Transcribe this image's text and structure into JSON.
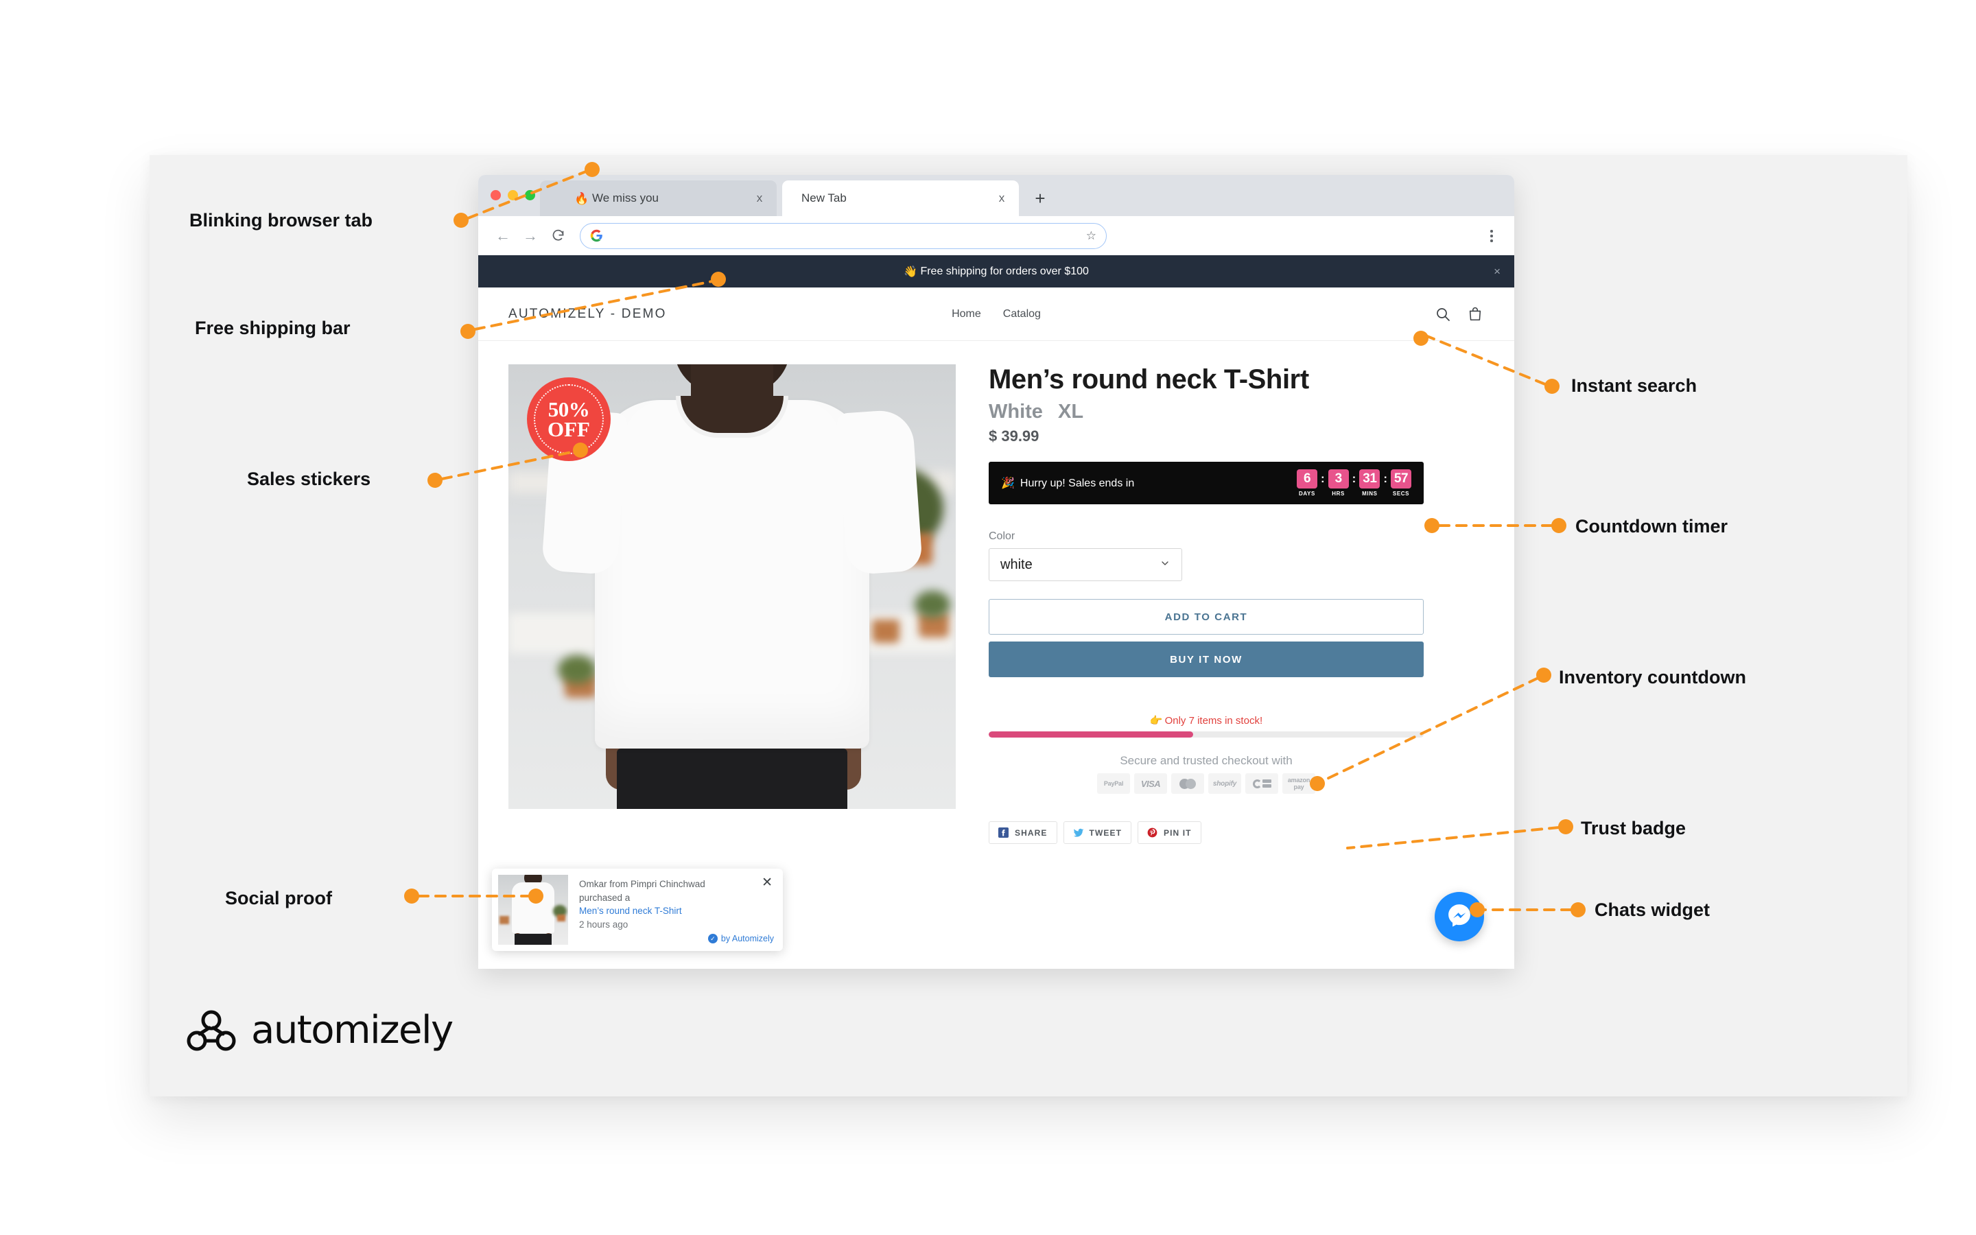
{
  "browser": {
    "tabs": [
      {
        "title": "We miss you",
        "favicon": "🔥",
        "active": false,
        "close_icon": "x"
      },
      {
        "title": "New Tab",
        "favicon": "",
        "active": true,
        "close_icon": "x"
      }
    ],
    "new_tab_icon": "+",
    "back_icon": "←",
    "forward_icon": "→",
    "reload_icon": "⟳",
    "omnibox_value": "",
    "omnibox_placeholder": "",
    "search_engine_icon": "google-g",
    "bookmark_icon": "☆",
    "menu_icon": "kebab"
  },
  "store": {
    "shipping_bar": {
      "emoji": "👋",
      "text": "Free shipping for orders over $100",
      "close_icon": "×"
    },
    "brand": "AUTOMIZELY - DEMO",
    "nav": [
      "Home",
      "Catalog"
    ],
    "search_icon": "search-icon",
    "cart_icon": "cart-icon"
  },
  "product": {
    "sticker": {
      "line1": "50%",
      "line2": "OFF"
    },
    "title": "Men’s round neck T-Shirt",
    "variant_color": "White",
    "variant_size": "XL",
    "price": "$ 39.99",
    "timer": {
      "emoji": "🎉",
      "message": "Hurry up! Sales ends in",
      "units": [
        {
          "value": "6",
          "label": "DAYS"
        },
        {
          "value": "3",
          "label": "HRS"
        },
        {
          "value": "31",
          "label": "MINS"
        },
        {
          "value": "57",
          "label": "SECS"
        }
      ],
      "separator": ":"
    },
    "option_label": "Color",
    "option_value": "white",
    "option_chevron": "⌄",
    "add_to_cart": "ADD TO CART",
    "buy_it_now": "BUY IT NOW",
    "stock": {
      "emoji": "👉",
      "text": "Only 7 items in stock!",
      "fill_percent": 47,
      "fill_color": "#da4a7b"
    },
    "trust": {
      "heading": "Secure and trusted checkout with",
      "badges": [
        "PayPal",
        "VISA",
        "mastercard",
        "shopify",
        "CB",
        "amazon pay"
      ]
    },
    "share": [
      {
        "label": "SHARE",
        "icon": "facebook-icon",
        "color": "#3b5998"
      },
      {
        "label": "TWEET",
        "icon": "twitter-icon",
        "color": "#4cb3ec"
      },
      {
        "label": "PIN IT",
        "icon": "pinterest-icon",
        "color": "#cb2027"
      }
    ]
  },
  "social_proof": {
    "line1": "Omkar from Pimpri Chinchwad",
    "line2": "purchased a",
    "product_link": "Men’s round neck T-Shirt",
    "time": "2 hours ago",
    "by_label": "by Automizely",
    "close_icon": "✕",
    "verified_icon": "✓"
  },
  "chat_widget": {
    "icon": "messenger-icon",
    "color": "#1b8cff"
  },
  "annotations": {
    "left": [
      "Blinking browser tab",
      "Free shipping bar",
      "Sales stickers",
      "Social proof"
    ],
    "right": [
      "Instant search",
      "Countdown timer",
      "Inventory countdown",
      "Trust badge",
      "Chats widget"
    ],
    "dot_color": "#f79520"
  },
  "footer": {
    "logo_text": "automizely"
  }
}
